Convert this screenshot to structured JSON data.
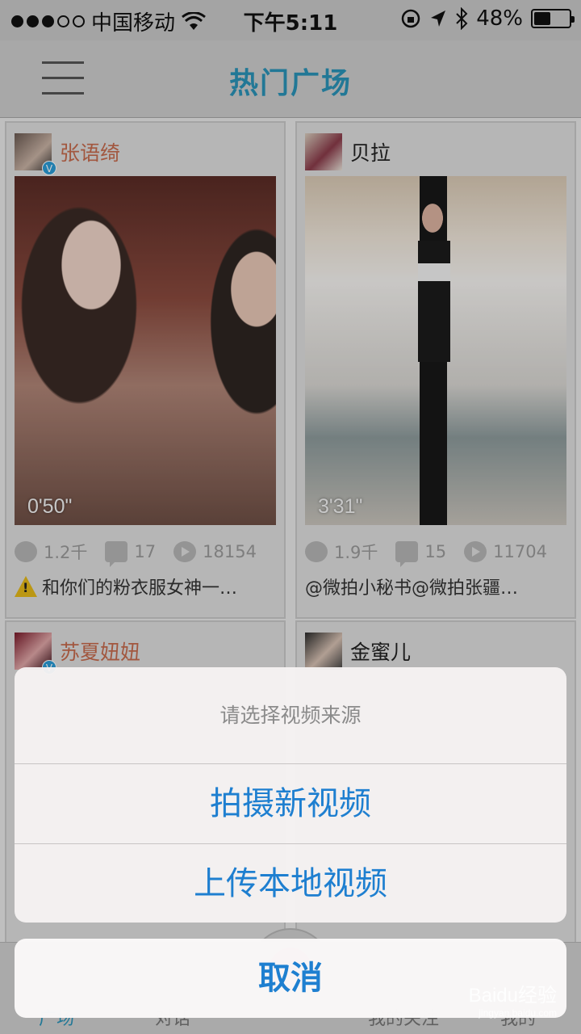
{
  "status_bar": {
    "carrier": "中国移动",
    "time": "下午5:11",
    "battery": "48%",
    "battery_level": 0.48
  },
  "nav": {
    "title": "热门广场"
  },
  "feed": {
    "cards": [
      {
        "author": "张语绮",
        "verified": true,
        "duration": "0'50\"",
        "gifts": "1.2千",
        "comments": "17",
        "plays": "18154",
        "caption": "和你们的粉衣服女神一…"
      },
      {
        "author": "贝拉",
        "verified": false,
        "duration": "3'31\"",
        "gifts": "1.9千",
        "comments": "15",
        "plays": "11704",
        "caption": "@微拍小秘书@微拍张疆…"
      },
      {
        "author": "苏夏妞妞",
        "verified": true
      },
      {
        "author": "金蜜儿",
        "verified": false
      }
    ]
  },
  "tab_bar": {
    "items": [
      "广场",
      "对话",
      "我的关注",
      "我的"
    ]
  },
  "action_sheet": {
    "title": "请选择视频来源",
    "options": [
      "拍摄新视频",
      "上传本地视频"
    ],
    "cancel": "取消"
  },
  "watermark": {
    "text": "Baidu经验",
    "url": "jingyan.baidu.com"
  },
  "colors": {
    "accent": "#2a93b8",
    "sheet_action": "#1e7fd0",
    "author_highlight": "#c66b4e"
  }
}
